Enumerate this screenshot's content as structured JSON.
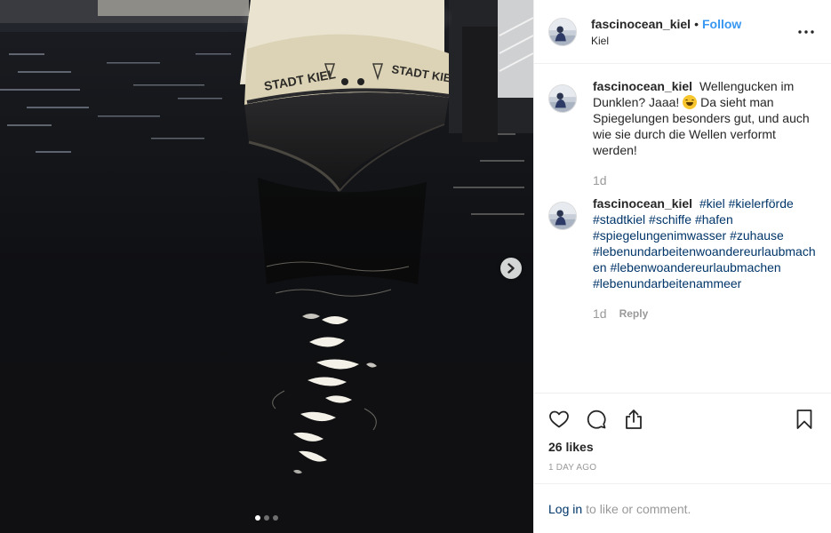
{
  "post": {
    "username": "fascinocean_kiel",
    "separator": "•",
    "follow_label": "Follow",
    "location": "Kiel",
    "more_icon": "more-options-icon"
  },
  "media": {
    "boat_name_left": "STADT KIEL",
    "boat_name_right": "STADT KIE",
    "carousel": {
      "count": 3,
      "active": 1
    }
  },
  "comments": [
    {
      "username": "fascinocean_kiel",
      "text_before": "Wellengucken im Dunklen? Jaaa!",
      "emoji": "grinning-face",
      "text_after": "Da sieht man Spiegelungen besonders gut, und auch wie sie durch die Wellen verformt werden!",
      "time": "1d"
    },
    {
      "username": "fascinocean_kiel",
      "hashtags": [
        "#kiel",
        "#kielerförde",
        "#stadtkiel",
        "#schiffe",
        "#hafen",
        "#spiegelungenimwasser",
        "#zuhause",
        "#lebenundarbeitenwoandereurlaubmachen",
        "#lebenwoandereurlaubmachen",
        "#lebenundarbeitenammeer"
      ],
      "time": "1d",
      "reply_label": "Reply"
    }
  ],
  "actions": {
    "likes": "26 likes",
    "date": "1 DAY AGO"
  },
  "login": {
    "link": "Log in",
    "text": "to like or comment."
  }
}
